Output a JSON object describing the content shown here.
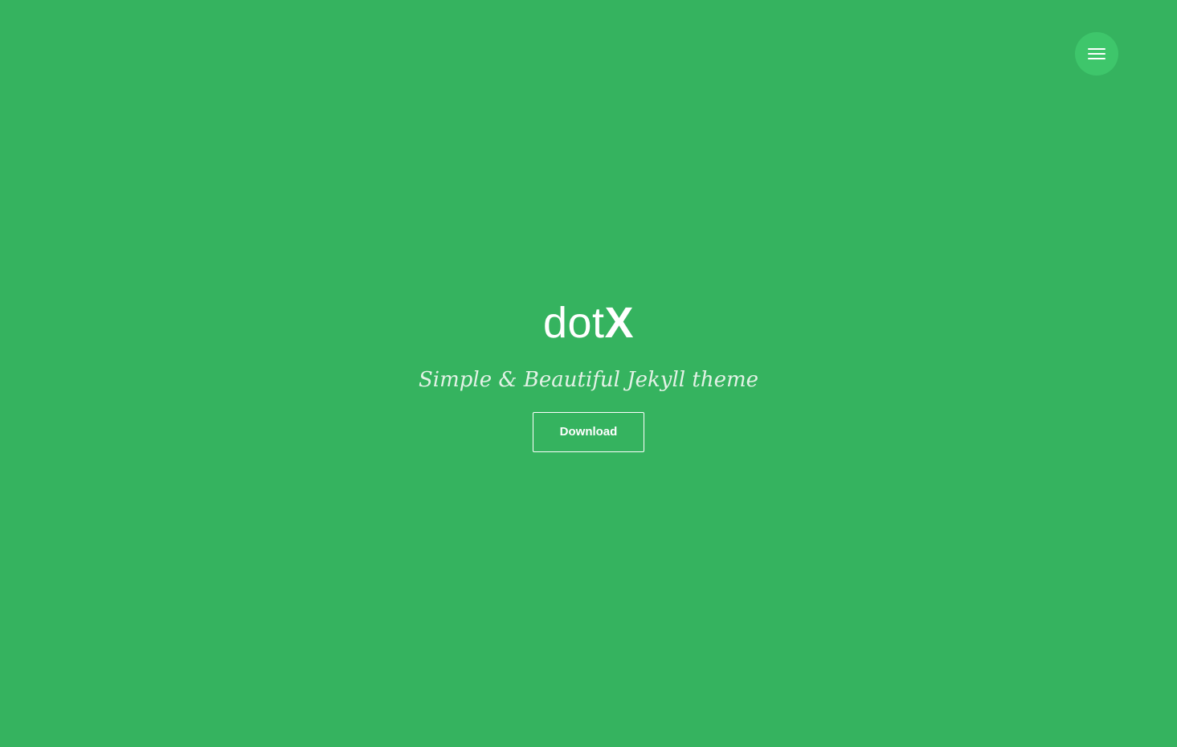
{
  "header": {
    "menu_icon": "hamburger-menu-icon"
  },
  "hero": {
    "logo_light": "dot",
    "logo_bold": "X",
    "tagline": "Simple & Beautiful Jekyll theme",
    "download_label": "Download"
  },
  "colors": {
    "background": "#35b35f",
    "menu_button": "#3ec66b",
    "text": "#ffffff",
    "tagline": "#e3f2e6"
  }
}
